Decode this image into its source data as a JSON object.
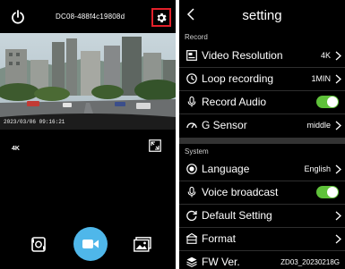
{
  "camera": {
    "device_id": "DC08-488f4c19808d",
    "timestamp": "2023/03/06  09:16:21",
    "resolution": "4K",
    "icons": {
      "power": "power-icon",
      "settings": "gear-icon",
      "expand": "fullscreen-icon",
      "switch_camera": "switch-camera-icon",
      "record": "video-camera-icon",
      "gallery": "gallery-icon"
    }
  },
  "settings": {
    "title": "setting",
    "sections": {
      "record": "Record",
      "system": "System"
    },
    "items": {
      "video_resolution": {
        "label": "Video Resolution",
        "value": "4K"
      },
      "loop_recording": {
        "label": "Loop recording",
        "value": "1MIN"
      },
      "record_audio": {
        "label": "Record Audio",
        "enabled": true
      },
      "g_sensor": {
        "label": "G Sensor",
        "value": "middle"
      },
      "language": {
        "label": "Language",
        "value": "English"
      },
      "voice_broadcast": {
        "label": "Voice broadcast",
        "enabled": true
      },
      "default_setting": {
        "label": "Default Setting"
      },
      "format": {
        "label": "Format"
      },
      "fw_ver": {
        "label": "FW Ver.",
        "value": "ZD03_20230218G"
      }
    }
  },
  "colors": {
    "accent_blue": "#4fb7ea",
    "toggle_green": "#5fc13a",
    "highlight_red": "#e2202a",
    "background": "#000000"
  }
}
